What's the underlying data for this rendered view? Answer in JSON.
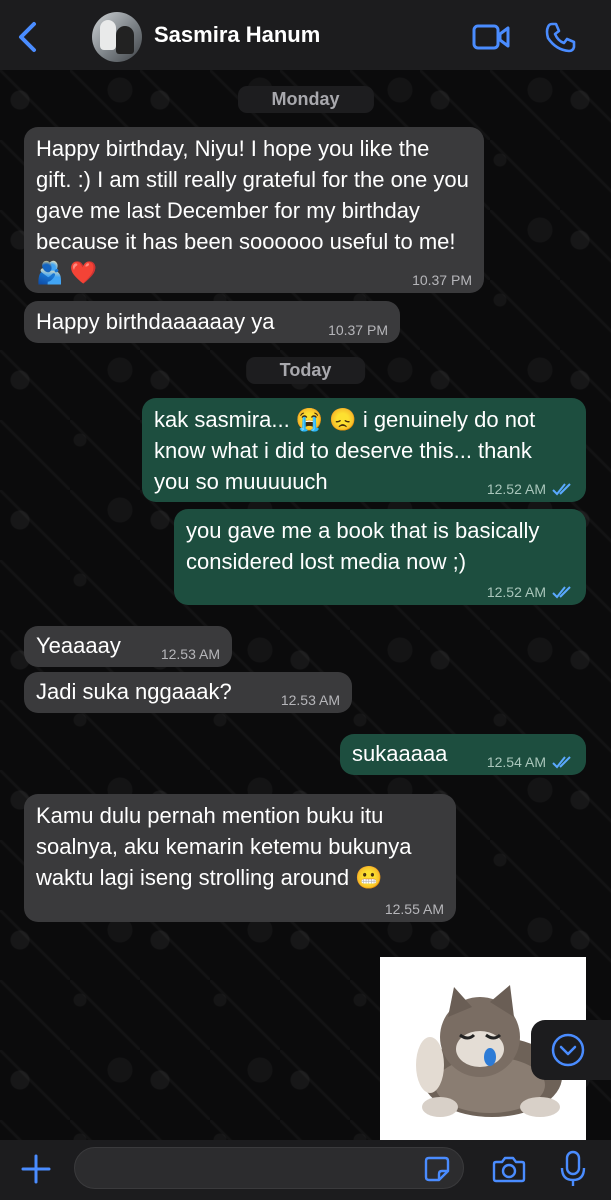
{
  "header": {
    "contact_name": "Sasmira Hanum",
    "icons": [
      "chevron-left-icon",
      "video-call-icon",
      "phone-call-icon"
    ]
  },
  "colors": {
    "accent": "#4a8cff",
    "incoming_bubble": "#3a3a3c",
    "outgoing_bubble": "#1d4e3f",
    "header_bg": "#1c1c1e"
  },
  "dates": {
    "monday": "Monday",
    "today": "Today"
  },
  "messages": [
    {
      "dir": "in",
      "text": "Happy birthday, Niyu! I hope you like the gift. :) I am still really grateful for the one you gave me last December for my birthday because it has been soooooo useful to me! 🫂 ❤️",
      "time": "10.37 PM"
    },
    {
      "dir": "in",
      "text": "Happy birthdaaaaaay ya",
      "time": "10.37 PM"
    },
    {
      "dir": "out",
      "text": "kak sasmira... 😭 😞 i genuinely do not know what i did to deserve this... thank you so muuuuuch",
      "time": "12.52 AM",
      "read": true
    },
    {
      "dir": "out",
      "text": "you gave me a book that is basically considered lost media now ;)",
      "time": "12.52 AM",
      "read": true
    },
    {
      "dir": "in",
      "text": "Yeaaaay",
      "time": "12.53 AM"
    },
    {
      "dir": "in",
      "text": "Jadi suka nggaaak?",
      "time": "12.53 AM"
    },
    {
      "dir": "out",
      "text": "sukaaaaa",
      "time": "12.54 AM",
      "read": true
    },
    {
      "dir": "in",
      "text": "Kamu dulu pernah mention buku itu soalnya, aku kemarin ketemu bukunya waktu lagi iseng strolling around 😬",
      "time": "12.55 AM"
    },
    {
      "dir": "out",
      "type": "sticker",
      "sticker": "crying-kitten-sticker"
    }
  ],
  "composer": {
    "value": "",
    "icons": [
      "plus-icon",
      "sticker-icon",
      "camera-icon",
      "microphone-icon"
    ]
  },
  "scroll_button": "chevron-down-icon"
}
